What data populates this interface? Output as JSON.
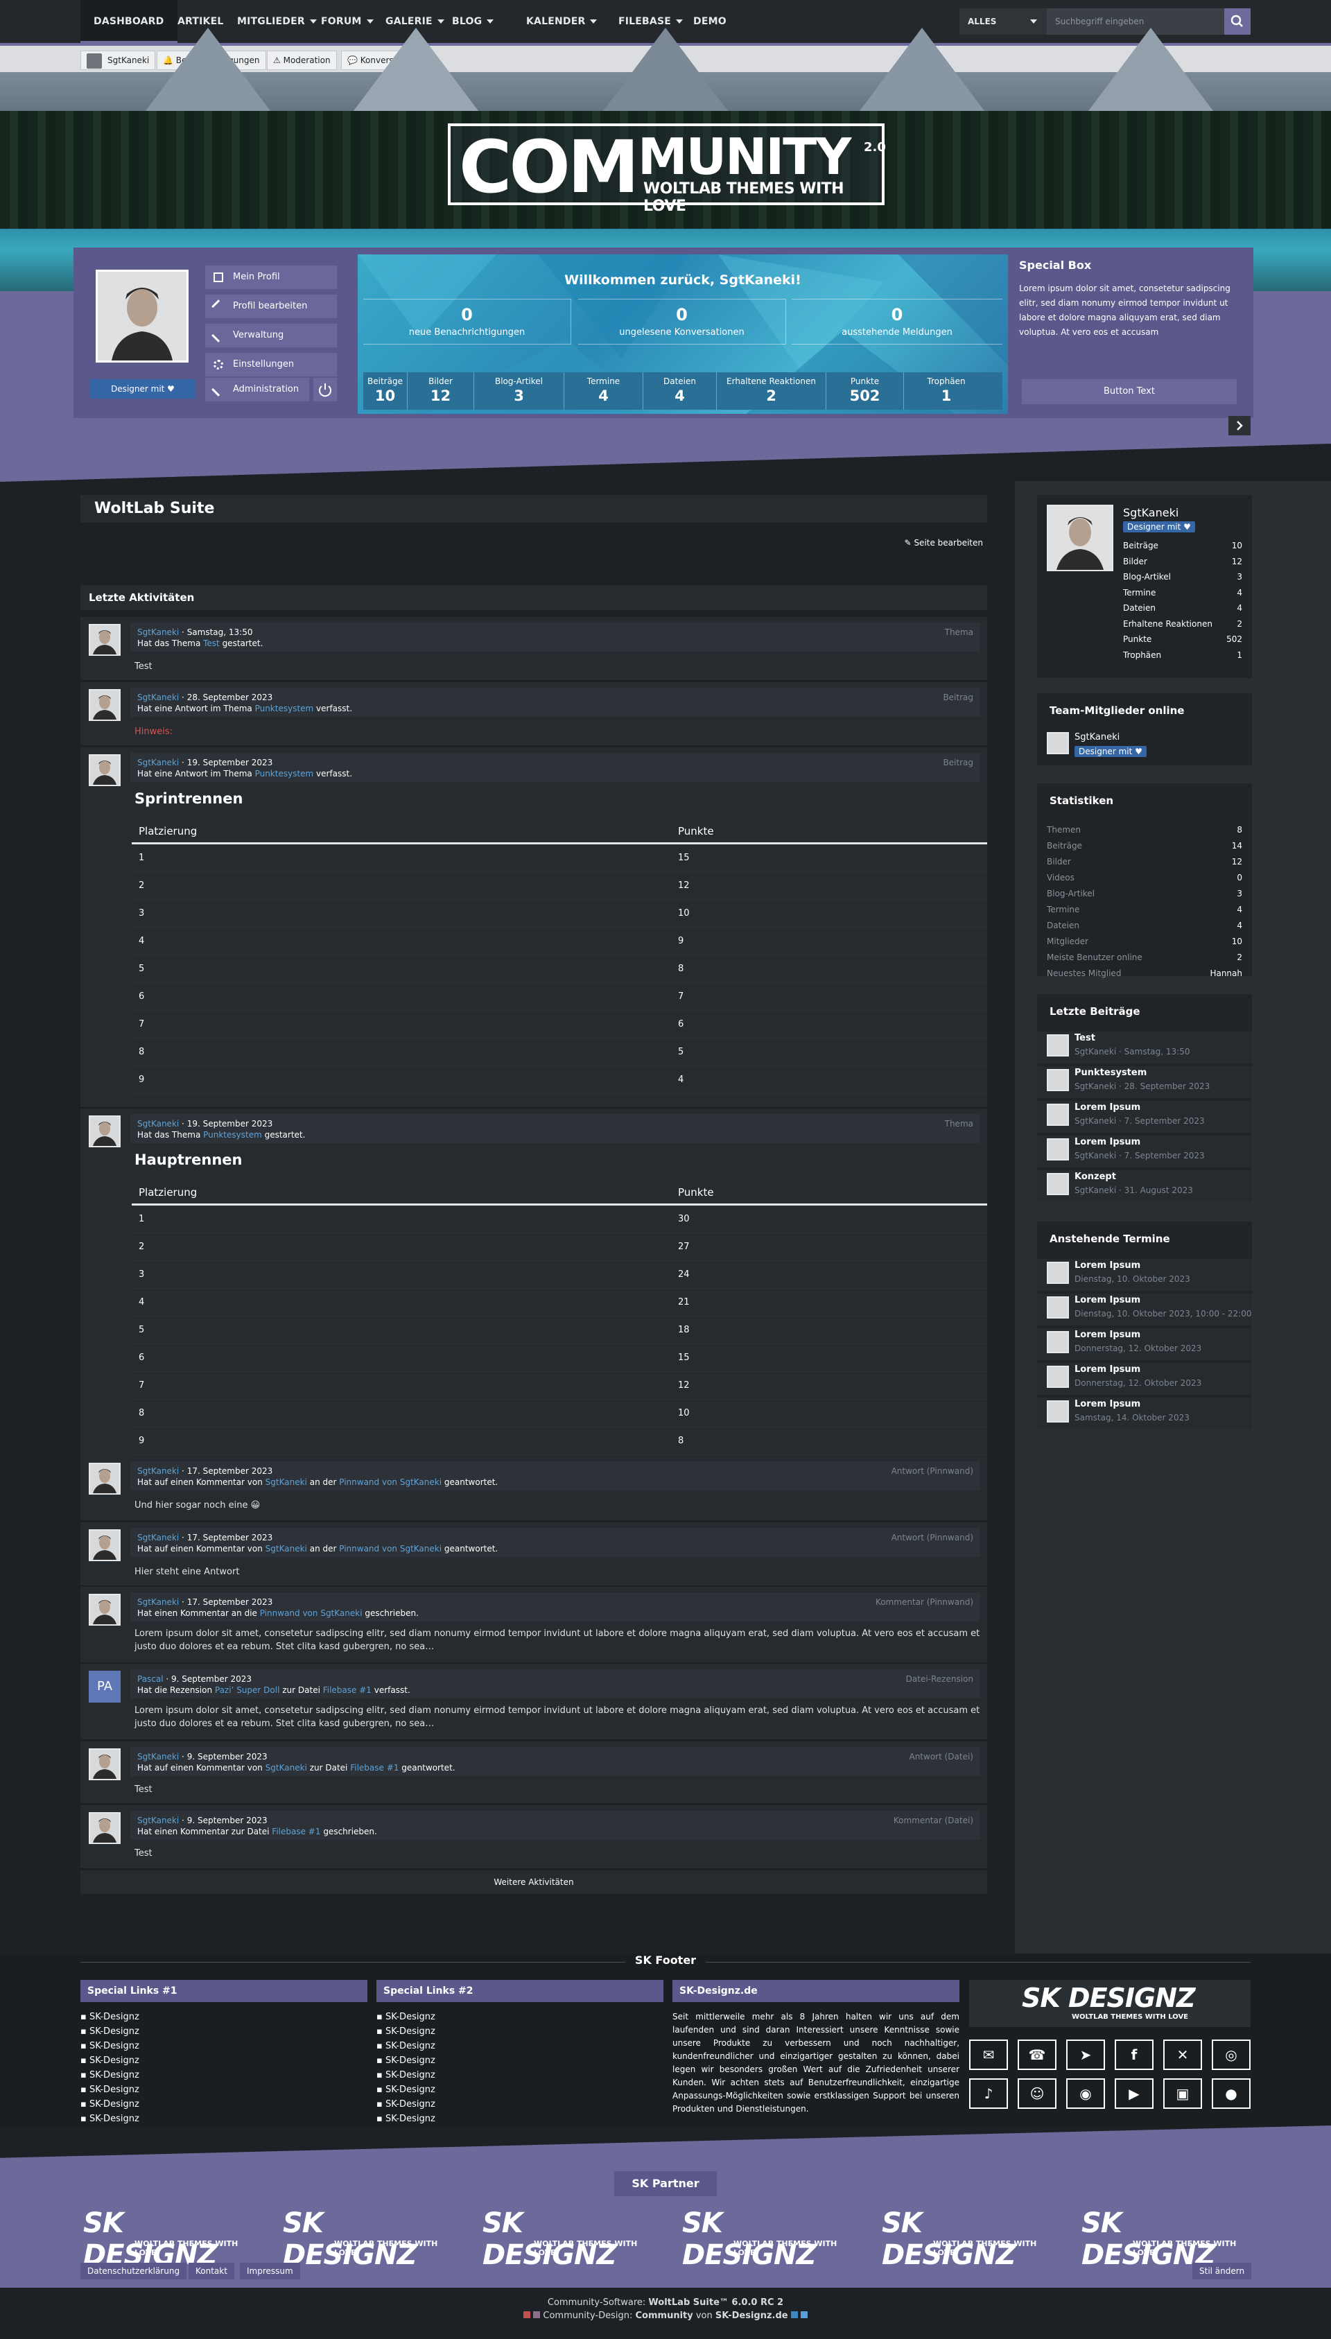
{
  "nav": {
    "items": [
      {
        "label": "DASHBOARD",
        "caret": false,
        "active": true
      },
      {
        "label": "ARTIKEL",
        "caret": false
      },
      {
        "label": "MITGLIEDER",
        "caret": true
      },
      {
        "label": "FORUM",
        "caret": true
      },
      {
        "label": "GALERIE",
        "caret": true
      },
      {
        "label": "BLOG",
        "caret": true
      },
      {
        "label": "KALENDER",
        "caret": true
      },
      {
        "label": "FILEBASE",
        "caret": true
      },
      {
        "label": "DEMO",
        "caret": false
      }
    ],
    "scope": "ALLES",
    "search_placeholder": "Suchbegriff eingeben"
  },
  "userbar": {
    "items": [
      "SgtKaneki",
      "Benachrichtigungen",
      "Moderation",
      "Konversationen"
    ]
  },
  "logo": {
    "com": "COM",
    "munity": "MUNITY",
    "sub": "WOLTLAB THEMES WITH LOVE",
    "ver": "2.0"
  },
  "profile": {
    "badge": "Designer mit ♥",
    "links": [
      "Mein Profil",
      "Profil bearbeiten",
      "Verwaltung",
      "Einstellungen",
      "Administration"
    ]
  },
  "welcome": {
    "title": "Willkommen zurück, SgtKaneki!",
    "counts": [
      {
        "value": "0",
        "label": "neue Benachrichtigungen"
      },
      {
        "value": "0",
        "label": "ungelesene Konversationen"
      },
      {
        "value": "0",
        "label": "ausstehende Meldungen"
      }
    ],
    "stats": [
      {
        "label": "Beiträge",
        "value": "10"
      },
      {
        "label": "Bilder",
        "value": "12"
      },
      {
        "label": "Blog-Artikel",
        "value": "3"
      },
      {
        "label": "Termine",
        "value": "4"
      },
      {
        "label": "Dateien",
        "value": "4"
      },
      {
        "label": "Erhaltene Reaktionen",
        "value": "2"
      },
      {
        "label": "Punkte",
        "value": "502"
      },
      {
        "label": "Trophäen",
        "value": "1"
      }
    ]
  },
  "special": {
    "title": "Special Box",
    "text": "Lorem ipsum dolor sit amet, consetetur sadipscing elitr, sed diam nonumy eirmod tempor invidunt ut labore et dolore magna aliquyam erat, sed diam voluptua. At vero eos et accusam",
    "button": "Button Text"
  },
  "main": {
    "title": "WoltLab Suite",
    "edit": "Seite bearbeiten",
    "activity_title": "Letzte Aktivitäten",
    "more": "Weitere Aktivitäten"
  },
  "activities": [
    {
      "user": "SgtKaneki",
      "date": "Samstag, 13:50",
      "pre": "Hat das Thema ",
      "link": "Test",
      "post": " gestartet.",
      "type": "Thema",
      "body": "Test"
    },
    {
      "user": "SgtKaneki",
      "date": "28. September 2023",
      "pre": "Hat eine Antwort im Thema ",
      "link": "Punktesystem",
      "post": " verfasst.",
      "type": "Beitrag",
      "body": "Hinweis:"
    },
    {
      "user": "SgtKaneki",
      "date": "19. September 2023",
      "pre": "Hat eine Antwort im Thema ",
      "link": "Punktesystem",
      "post": " verfasst.",
      "type": "Beitrag",
      "heading": "Sprintrennen"
    },
    {
      "user": "SgtKaneki",
      "date": "19. September 2023",
      "pre": "Hat das Thema ",
      "link": "Punktesystem",
      "post": " gestartet.",
      "type": "Thema",
      "heading": "Hauptrennen"
    },
    {
      "user": "SgtKaneki",
      "date": "17. September 2023",
      "pre": "Hat auf einen Kommentar von ",
      "link": "SgtKaneki",
      "mid": " an der ",
      "link2": "Pinnwand von SgtKaneki",
      "post": " geantwortet.",
      "type": "Antwort (Pinnwand)",
      "body": "Und hier sogar noch eine 😀"
    },
    {
      "user": "SgtKaneki",
      "date": "17. September 2023",
      "pre": "Hat auf einen Kommentar von ",
      "link": "SgtKaneki",
      "mid": " an der ",
      "link2": "Pinnwand von SgtKaneki",
      "post": " geantwortet.",
      "type": "Antwort (Pinnwand)",
      "body": "Hier steht eine Antwort"
    },
    {
      "user": "SgtKaneki",
      "date": "17. September 2023",
      "pre": "Hat einen Kommentar an die ",
      "link": "Pinnwand von SgtKaneki",
      "post": " geschrieben.",
      "type": "Kommentar (Pinnwand)",
      "body": "Lorem ipsum dolor sit amet, consetetur sadipscing elitr, sed diam nonumy eirmod tempor invidunt ut labore et dolore magna aliquyam erat, sed diam voluptua. At vero eos et accusam et justo duo dolores et ea rebum. Stet clita kasd gubergren, no sea…"
    },
    {
      "user": "Pascal",
      "initials": "PA",
      "date": "9. September 2023",
      "pre": "Hat die Rezension ",
      "link": "Pazi’ Super Doll",
      "mid": " zur Datei ",
      "link2": "Filebase #1",
      "post": " verfasst.",
      "type": "Datei-Rezension",
      "body": "Lorem ipsum dolor sit amet, consetetur sadipscing elitr, sed diam nonumy eirmod tempor invidunt ut labore et dolore magna aliquyam erat, sed diam voluptua. At vero eos et accusam et justo duo dolores et ea rebum. Stet clita kasd gubergren, no sea…"
    },
    {
      "user": "SgtKaneki",
      "date": "9. September 2023",
      "pre": "Hat auf einen Kommentar von ",
      "link": "SgtKaneki",
      "mid": " zur Datei ",
      "link2": "Filebase #1",
      "post": " geantwortet.",
      "type": "Antwort (Datei)",
      "body": "Test"
    },
    {
      "user": "SgtKaneki",
      "date": "9. September 2023",
      "pre": "Hat einen Kommentar zur Datei ",
      "link": "Filebase #1",
      "post": " geschrieben.",
      "type": "Kommentar (Datei)",
      "body": "Test"
    }
  ],
  "tables": {
    "head": [
      "Platzierung",
      "Punkte"
    ],
    "sprint": [
      [
        "1",
        "15"
      ],
      [
        "2",
        "12"
      ],
      [
        "3",
        "10"
      ],
      [
        "4",
        "9"
      ],
      [
        "5",
        "8"
      ],
      [
        "6",
        "7"
      ],
      [
        "7",
        "6"
      ],
      [
        "8",
        "5"
      ],
      [
        "9",
        "4"
      ]
    ],
    "haupt": [
      [
        "1",
        "30"
      ],
      [
        "2",
        "27"
      ],
      [
        "3",
        "24"
      ],
      [
        "4",
        "21"
      ],
      [
        "5",
        "18"
      ],
      [
        "6",
        "15"
      ],
      [
        "7",
        "12"
      ],
      [
        "8",
        "10"
      ],
      [
        "9",
        "8"
      ]
    ]
  },
  "sidebar": {
    "user": {
      "name": "SgtKaneki",
      "badge": "Designer mit ♥",
      "stats": [
        [
          "Beiträge",
          "10"
        ],
        [
          "Bilder",
          "12"
        ],
        [
          "Blog-Artikel",
          "3"
        ],
        [
          "Termine",
          "4"
        ],
        [
          "Dateien",
          "4"
        ],
        [
          "Erhaltene Reaktionen",
          "2"
        ],
        [
          "Punkte",
          "502"
        ],
        [
          "Trophäen",
          "1"
        ]
      ]
    },
    "team": {
      "title": "Team-Mitglieder online",
      "name": "SgtKaneki",
      "badge": "Designer mit ♥"
    },
    "stats": {
      "title": "Statistiken",
      "rows": [
        [
          "Themen",
          "8"
        ],
        [
          "Beiträge",
          "14"
        ],
        [
          "Bilder",
          "12"
        ],
        [
          "Videos",
          "0"
        ],
        [
          "Blog-Artikel",
          "3"
        ],
        [
          "Termine",
          "4"
        ],
        [
          "Dateien",
          "4"
        ],
        [
          "Mitglieder",
          "10"
        ],
        [
          "Meiste Benutzer online",
          "2"
        ],
        [
          "Neuestes Mitglied",
          "Hannah"
        ]
      ]
    },
    "posts": {
      "title": "Letzte Beiträge",
      "items": [
        [
          "Test",
          "SgtKaneki · Samstag, 13:50"
        ],
        [
          "Punktesystem",
          "SgtKaneki · 28. September 2023"
        ],
        [
          "Lorem Ipsum",
          "SgtKaneki · 7. September 2023"
        ],
        [
          "Lorem Ipsum",
          "SgtKaneki · 7. September 2023"
        ],
        [
          "Konzept",
          "SgtKaneki · 31. August 2023"
        ]
      ]
    },
    "events": {
      "title": "Anstehende Termine",
      "items": [
        [
          "Lorem Ipsum",
          "Dienstag, 10. Oktober 2023"
        ],
        [
          "Lorem Ipsum",
          "Dienstag, 10. Oktober 2023, 10:00 - 22:00"
        ],
        [
          "Lorem Ipsum",
          "Donnerstag, 12. Oktober 2023"
        ],
        [
          "Lorem Ipsum",
          "Donnerstag, 12. Oktober 2023"
        ],
        [
          "Lorem Ipsum",
          "Samstag, 14. Oktober 2023"
        ]
      ]
    }
  },
  "footer": {
    "title": "SK Footer",
    "col1": {
      "title": "Special Links #1",
      "items": [
        "SK-Designz",
        "SK-Designz",
        "SK-Designz",
        "SK-Designz",
        "SK-Designz",
        "SK-Designz",
        "SK-Designz",
        "SK-Designz"
      ]
    },
    "col2": {
      "title": "Special Links #2",
      "items": [
        "SK-Designz",
        "SK-Designz",
        "SK-Designz",
        "SK-Designz",
        "SK-Designz",
        "SK-Designz",
        "SK-Designz",
        "SK-Designz"
      ]
    },
    "col3": {
      "title": "SK-Designz.de",
      "text": "Seit mittlerweile mehr als 8 Jahren halten wir uns auf dem laufenden und sind daran Interessiert unsere Kenntnisse sowie unsere Produkte zu verbessern und noch nachhaltiger, kundenfreundlicher und einzigartiger gestalten zu können, dabei legen wir besonders großen Wert auf die Zufriedenheit unserer Kunden. Wir achten stets auf Benutzerfreundlichkeit, einzigartige Anpassungs-Möglichkeiten sowie erstklassigen Support bei unseren Produkten und Dienstleistungen."
    },
    "brand": "SK DESIGNZ",
    "brand_sub": "WOLTLAB THEMES WITH LOVE",
    "social_icons": [
      "mail-icon",
      "whatsapp-icon",
      "telegram-icon",
      "facebook-icon",
      "x-icon",
      "instagram-icon",
      "tiktok-icon",
      "discord-icon",
      "spotify-icon",
      "youtube-icon",
      "twitch-icon",
      "reddit-icon"
    ]
  },
  "partner": {
    "title": "SK Partner",
    "links": [
      "Datenschutzerklärung",
      "Kontakt",
      "Impressum"
    ],
    "style": "Stil ändern"
  },
  "copyright": {
    "line1_pre": "Community-Software: ",
    "line1_b": "WoltLab Suite™ 6.0.0 RC 2",
    "line2_pre": "Community-Design: ",
    "line2_b1": "Community",
    "line2_mid": " von ",
    "line2_b2": "SK-Designz.de"
  },
  "colors": {
    "accent": "#6d6b9c",
    "badge": "#3566a6",
    "link": "#5fa2d8"
  }
}
